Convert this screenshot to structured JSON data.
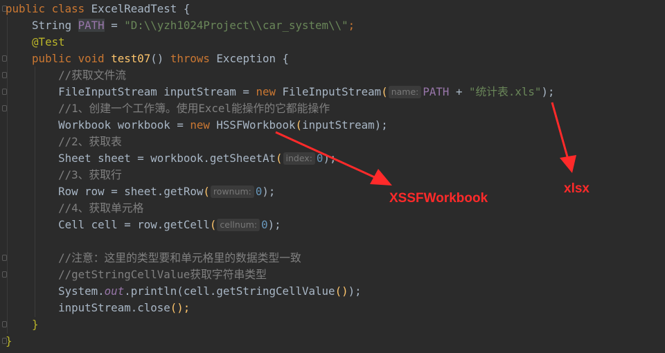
{
  "code": {
    "kw_public": "public",
    "kw_class": "class",
    "class_name": "ExcelReadTest",
    "brace_open": "{",
    "brace_close": "}",
    "type_string": "String",
    "field_path": "PATH",
    "equals": "=",
    "path_value": "\"D:\\\\yzh1024Project\\\\car_system\\\\\"",
    "semicolon": ";",
    "annotation": "@Test",
    "kw_void": "void",
    "method_name": "test07",
    "parens": "()",
    "kw_throws": "throws",
    "exception_type": "Exception",
    "comment_1": "//获取文件流",
    "type_fis": "FileInputStream",
    "var_input_stream": "inputStream",
    "kw_new": "new",
    "paren_open": "(",
    "paren_close_semi": ");",
    "hint_name": "name:",
    "plus": "+",
    "file_name_str": "\"统计表.xls\"",
    "comment_2": "//1、创建一个工作簿。使用Excel能操作的它都能操作",
    "type_workbook": "Workbook",
    "var_workbook": "workbook",
    "type_hssf": "HSSFWorkbook",
    "arg_input_stream": "inputStream",
    "comment_3": "//2、获取表",
    "type_sheet": "Sheet",
    "var_sheet": "sheet",
    "call_get_sheet_at": "workbook.getSheetAt",
    "hint_index": "index:",
    "zero": "0",
    "comment_4": "//3、获取行",
    "type_row": "Row",
    "var_row": "row",
    "call_get_row": "sheet.getRow",
    "hint_rownum": "rownum:",
    "comment_5": "//4、获取单元格",
    "type_cell": "Cell",
    "var_cell": "cell",
    "call_get_cell": "row.getCell",
    "hint_cellnum": "cellnum:",
    "comment_6": "//注意：这里的类型要和单元格里的数据类型一致",
    "comment_7": "//getStringCellValue获取字符串类型",
    "system_prefix": "System.",
    "static_out": "out",
    "println_call": ".println(",
    "cell_getter": "cell.getStringCellValue",
    "close_tail": ");",
    "close_call": "inputStream.close",
    "unit_tail": "();"
  },
  "annotations": {
    "xssf_label": "XSSFWorkbook",
    "xlsx_label": "xlsx"
  },
  "colors": {
    "background": "#2b2b2b",
    "keyword": "#cc7832",
    "string": "#6a8759",
    "number": "#6897bb",
    "method": "#ffc66d",
    "annotation": "#bbb529",
    "comment": "#808080",
    "field": "#9876aa",
    "annotation_red": "#ff2a2a"
  }
}
